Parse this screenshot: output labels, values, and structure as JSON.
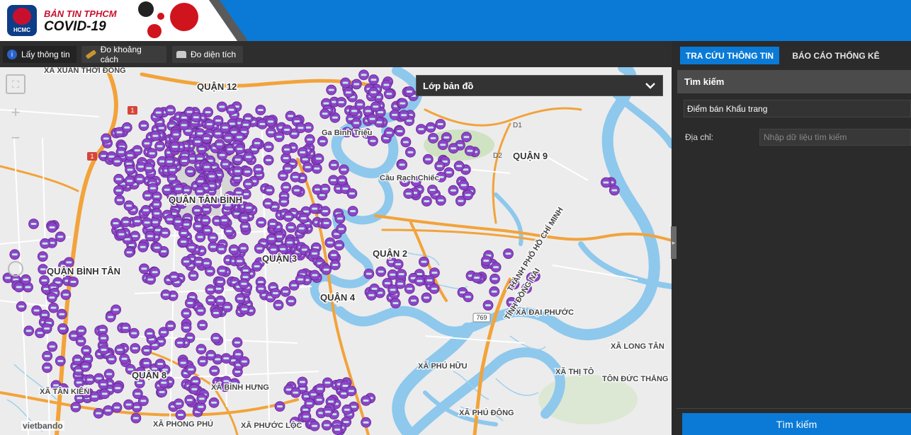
{
  "header": {
    "logo_badge_text": "HCMC",
    "logo_line1": "BẢN TIN TPHCM",
    "logo_line2": "COVID-19"
  },
  "toolbar": {
    "get_info_label": "Lấy thông tin",
    "measure_distance_label": "Đo khoảng cách",
    "measure_area_label": "Đo diện tích"
  },
  "map": {
    "layer_dropdown_label": "Lớp bản đồ",
    "credit": "vietbando",
    "district_labels": [
      "QUẬN 12",
      "QUẬN 9",
      "QUẬN 2",
      "QUẬN BÌNH TÂN",
      "QUẬN TÂN BÌNH",
      "QUẬN 3",
      "QUẬN 8",
      "QUẬN 4"
    ],
    "place_labels": [
      "XÃ XUÂN THỚI ĐÔNG",
      "XÃ BÌNH HƯNG",
      "XÃ PHONG PHÚ",
      "XÃ PHƯỚC LỘC",
      "XÃ TÂN KIÊN",
      "XÃ ĐẠI PHƯỚC",
      "XÃ LONG TÂN",
      "XÃ PHÚ HỮU",
      "XÃ PHÚ ĐÔNG",
      "XÃ THỊ TÔ",
      "TÔN ĐỨC THẮNG",
      "THÀNH PHỐ HỒ CHÍ MINH",
      "TỈNH ĐỒNG NAI",
      "Cầu Rạch Chiếc",
      "Ga Bình Triệu"
    ],
    "route_labels": [
      "1",
      "1",
      "769",
      "D1",
      "D2"
    ]
  },
  "panel": {
    "tab_lookup": "TRA CỨU THÔNG TIN",
    "tab_report": "BÁO CÁO THỐNG KÊ",
    "search_heading": "Tìm kiếm",
    "layer_selected": "Điểm bán Khẩu trang",
    "address_label": "Địa chỉ:",
    "address_placeholder": "Nhập dữ liệu tìm kiếm",
    "search_button": "Tìm kiếm"
  },
  "colors": {
    "header_blue": "#0a7ad6",
    "marker_purple": "#8e44c9",
    "river_blue": "#8ec8ec",
    "road_orange": "#f2a33a",
    "panel_dark": "#2b2b2b"
  }
}
